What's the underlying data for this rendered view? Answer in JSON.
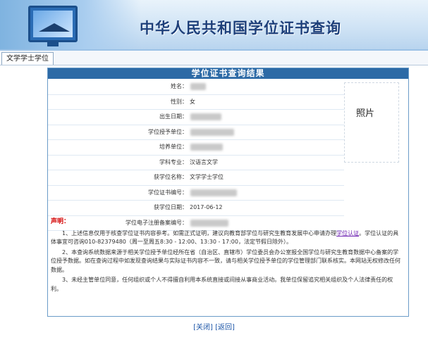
{
  "banner": {
    "title": "中华人民共和国学位证书查询"
  },
  "tab": {
    "label": "文学学士学位"
  },
  "panel": {
    "title": "学位证书查询结果"
  },
  "rows": [
    {
      "label": "姓名：",
      "value": "",
      "redacted": true
    },
    {
      "label": "性别：",
      "value": "女",
      "redacted": false
    },
    {
      "label": "出生日期：",
      "value": "",
      "redacted": true
    },
    {
      "label": "学位授予单位：",
      "value": "",
      "redacted": true
    },
    {
      "label": "培养单位：",
      "value": "",
      "redacted": true
    },
    {
      "label": "学科专业：",
      "value": "汉语言文学",
      "redacted": false
    },
    {
      "label": "获学位名称：",
      "value": "文学学士学位",
      "redacted": false
    },
    {
      "label": "学位证书编号：",
      "value": "",
      "redacted": true
    },
    {
      "label": "获学位日期：",
      "value": "2017-06-12",
      "redacted": false
    },
    {
      "label": "学位电子注册备案编号：",
      "value": "",
      "redacted": true
    }
  ],
  "photo": {
    "label": "照片"
  },
  "notes": {
    "heading": "声明：",
    "p1_text": "1、上述信息仅用于核查学位证书内容参考。如需正式证明，建议向教育部学位与研究生教育发展中心申请办理",
    "p1_link": "学位认证",
    "p1_tail": "。学位认证的具体事宜可咨询010-82379480（周一至周五8:30 - 12:00、13:30 - 17:00，法定节假日除外）。",
    "p2": "2、本查询系统数据来源于相关学位授予单位经所在省（自治区、直辖市）学位委员会办公室报全国学位与研究生教育数据中心备案的学位授予数据。如在查询过程中如发现查询结果与实际证书内容不一致，请与相关学位授予单位的学位管理部门联系核实。本网站无权修改任何数据。",
    "p3": "3、未经主管单位同意，任何组织或个人不得擅自利用本系统直接或间接从事商业活动。我单位保留追究相关组织及个人法律责任的权利。"
  },
  "links": {
    "close": "[关闭]",
    "back": "[返回]"
  }
}
